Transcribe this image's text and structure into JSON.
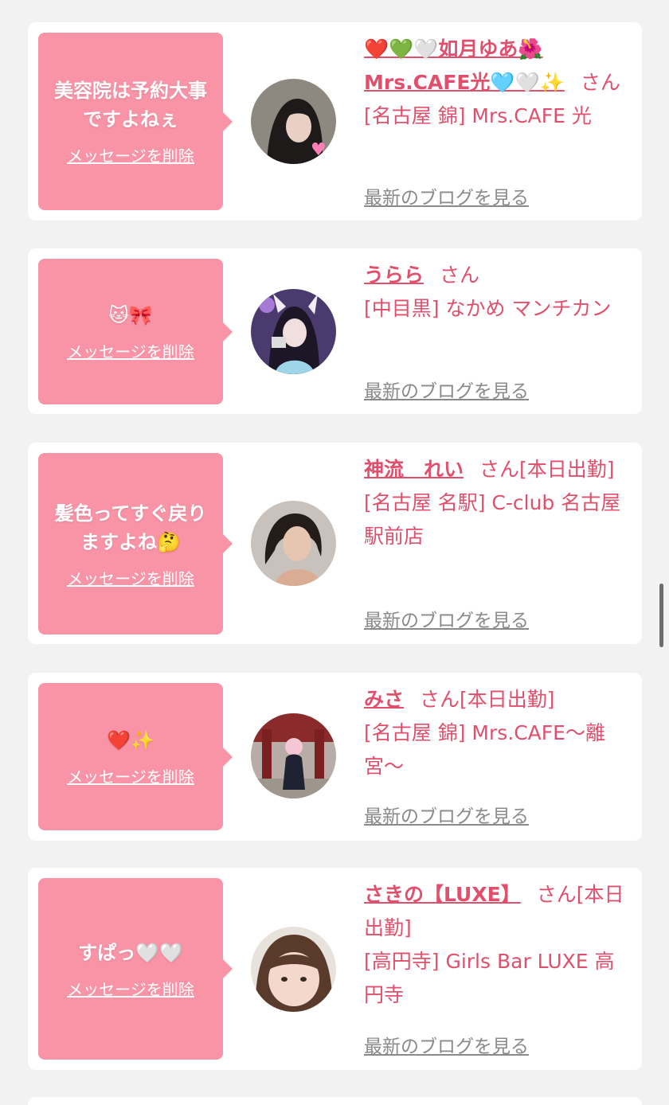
{
  "messages": [
    {
      "bubble_text": "美容院は予約大事\nですよねぇ",
      "delete_label": "メッセージを削除",
      "name": "❤️💚🤍如月ゆあ🌺Mrs.CAFE光🩵🤍✨",
      "honorific": "さん",
      "status": "",
      "shop": "[名古屋 錦] Mrs.CAFE 光",
      "blog_label": "最新のブログを見る"
    },
    {
      "bubble_text": "🐱🎀",
      "delete_label": "メッセージを削除",
      "name": "うらら",
      "honorific": "さん",
      "status": "",
      "shop": "[中目黒] なかめ マンチカン",
      "blog_label": "最新のブログを見る"
    },
    {
      "bubble_text": "髪色ってすぐ戻り\nますよね🤔",
      "delete_label": "メッセージを削除",
      "name": "神流　れい",
      "honorific": "さん",
      "status": "[本日出勤]",
      "shop": "[名古屋 名駅] C-club 名古屋駅前店",
      "blog_label": "最新のブログを見る"
    },
    {
      "bubble_text": "❤️✨",
      "delete_label": "メッセージを削除",
      "name": "みさ",
      "honorific": "さん",
      "status": "[本日出勤]",
      "shop": "[名古屋 錦] Mrs.CAFE〜離宮〜",
      "blog_label": "最新のブログを見る"
    },
    {
      "bubble_text": "すぱっ🤍🤍",
      "delete_label": "メッセージを削除",
      "name": "さきの【LUXE】",
      "honorific": "さん",
      "status": "[本日出勤]",
      "shop": "[高円寺] Girls Bar LUXE 高円寺",
      "blog_label": "最新のブログを見る"
    }
  ],
  "colors": {
    "bubble": "#f994a7",
    "name_text": "#e0506c",
    "blog_link": "#8a8a8a",
    "card": "#ffffff",
    "background": "#f2f2f2"
  }
}
